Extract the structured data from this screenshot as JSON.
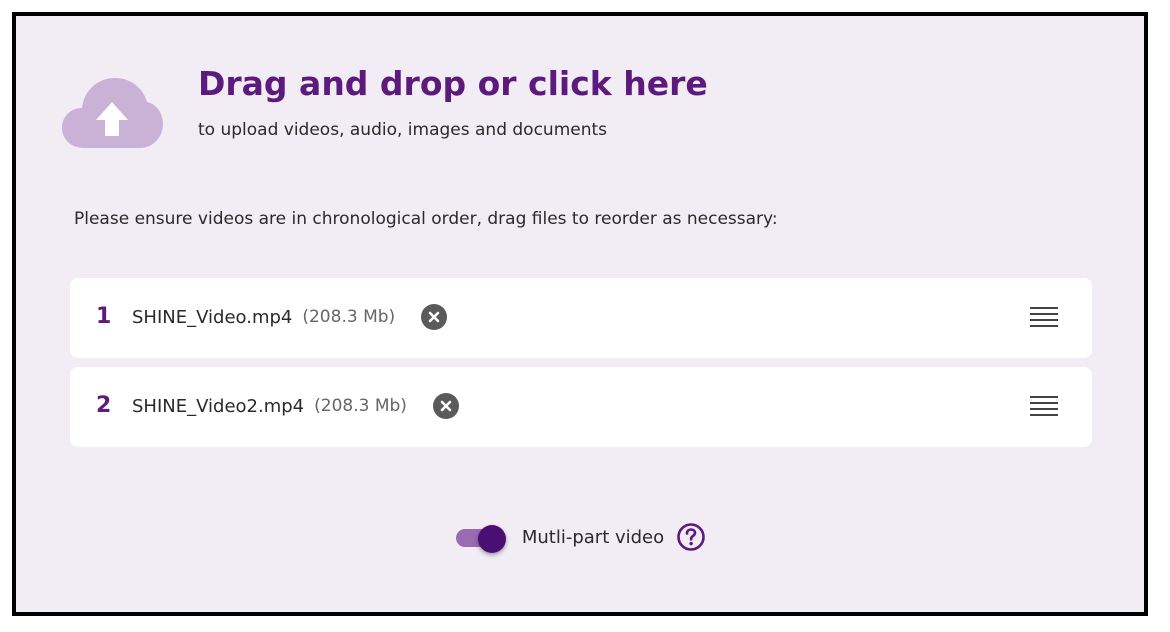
{
  "dropzone": {
    "title": "Drag and drop or click here",
    "subtitle": "to upload videos, audio, images and documents",
    "icon": "cloud-upload-icon"
  },
  "instructions": "Please ensure videos are in chronological order, drag files to reorder as necessary:",
  "files": [
    {
      "index": "1",
      "name": "SHINE_Video.mp4",
      "size": "(208.3 Mb)"
    },
    {
      "index": "2",
      "name": "SHINE_Video2.mp4",
      "size": "(208.3 Mb)"
    }
  ],
  "multipart": {
    "label": "Mutli-part video",
    "enabled": true,
    "help_icon": "question-circle-icon"
  },
  "colors": {
    "accent": "#5b1a7c",
    "background": "#f2ecf4",
    "cloud": "#c9b2d6",
    "toggle_track": "#9a6bb3",
    "toggle_thumb": "#4a0f72"
  }
}
